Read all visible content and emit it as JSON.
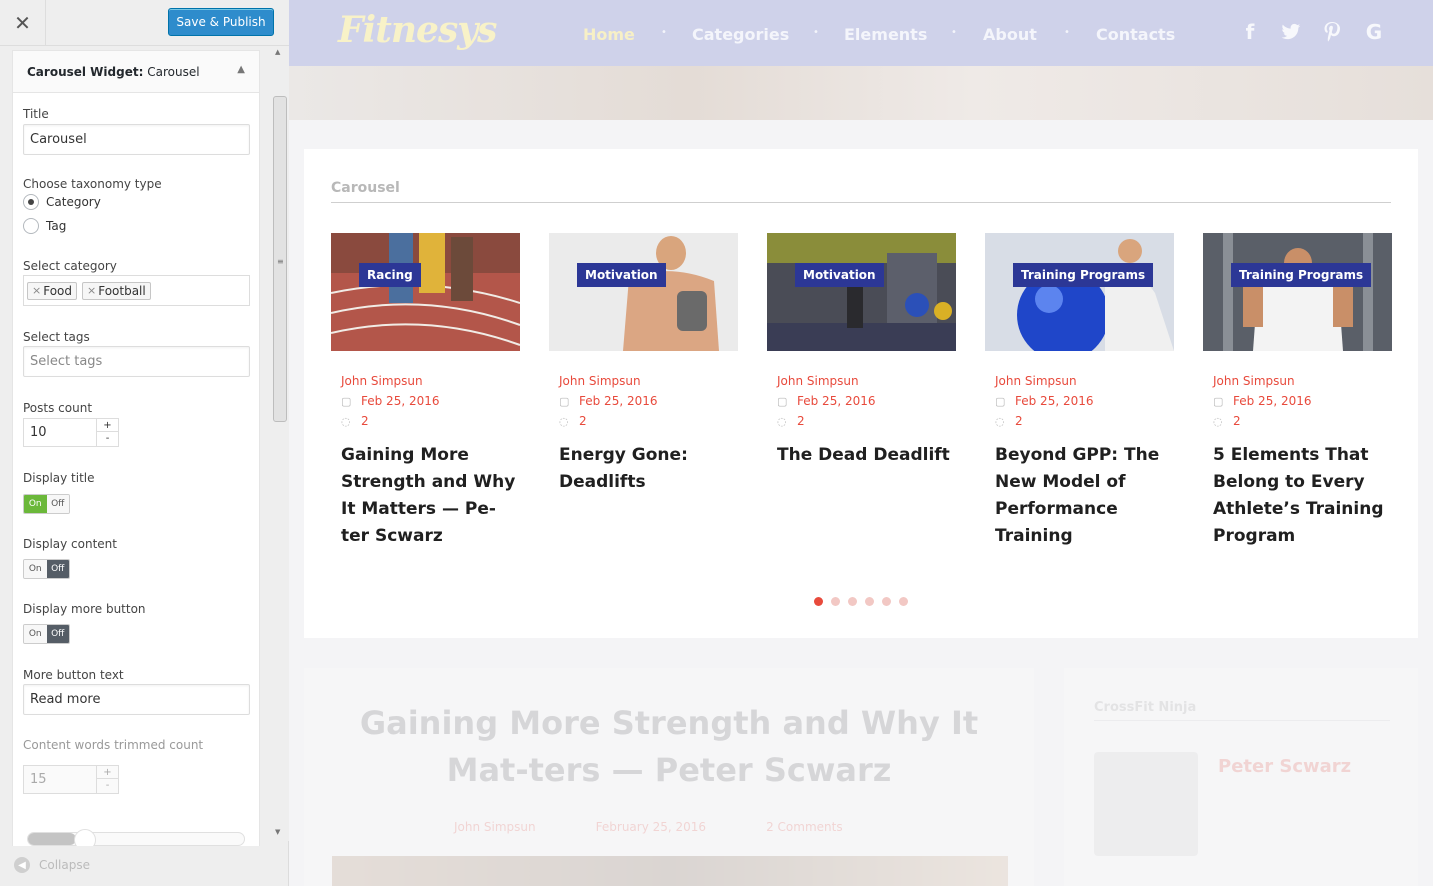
{
  "sidebar": {
    "close_icon": "close-icon",
    "publish_label": "Save & Publish",
    "widget_header": {
      "prefix": "Carousel Widget:",
      "name": "Carousel"
    },
    "fields": {
      "title_label": "Title",
      "title_value": "Carousel",
      "taxonomy_label": "Choose taxonomy type",
      "taxonomy_options": [
        "Category",
        "Tag"
      ],
      "taxonomy_selected": "Category",
      "category_label": "Select category",
      "categories": [
        "Food",
        "Football"
      ],
      "tags_label": "Select tags",
      "tags_placeholder": "Select tags",
      "posts_count_label": "Posts count",
      "posts_count_value": "10",
      "display_title_label": "Display title",
      "display_content_label": "Display content",
      "display_more_label": "Display more button",
      "toggle_on": "On",
      "toggle_off": "Off",
      "display_title_state": "on",
      "display_content_state": "off",
      "display_more_state": "off",
      "more_text_label": "More button text",
      "more_text_value": "Read more",
      "trim_label": "Content words trimmed count",
      "trim_value": "15"
    },
    "collapse_label": "Collapse"
  },
  "site": {
    "logo": "Fitnesys",
    "nav": [
      "Home",
      "Categories",
      "Elements",
      "About",
      "Contacts"
    ],
    "active_nav": "Home",
    "social": [
      "facebook-icon",
      "twitter-icon",
      "pinterest-icon",
      "google-icon"
    ],
    "carousel_heading": "Carousel",
    "slides": [
      {
        "badge": "Racing",
        "author": "John Simpsun",
        "date": "Feb 25, 2016",
        "comments": "2",
        "title": "Gaining More Strength and Why It Matters — Pe-ter Scwarz"
      },
      {
        "badge": "Motivation",
        "author": "John Simpsun",
        "date": "Feb 25, 2016",
        "comments": "2",
        "title": "Energy Gone: Deadlifts"
      },
      {
        "badge": "Motivation",
        "author": "John Simpsun",
        "date": "Feb 25, 2016",
        "comments": "2",
        "title": "The Dead Deadlift"
      },
      {
        "badge": "Training Programs",
        "author": "John Simpsun",
        "date": "Feb 25, 2016",
        "comments": "2",
        "title": "Beyond GPP: The New Model of Performance Training"
      },
      {
        "badge": "Training Programs",
        "author": "John Simpsun",
        "date": "Feb 25, 2016",
        "comments": "2",
        "title": "5 Elements That Belong to Every Athlete’s Training Program"
      }
    ],
    "dots_count": 6,
    "active_dot": 0,
    "post": {
      "title": "Gaining More Strength and Why It Mat-ters — Peter Scwarz",
      "author": "John Simpsun",
      "date": "February 25, 2016",
      "comments": "2 Comments"
    },
    "side_widget": {
      "title": "CrossFit Ninja",
      "name": "Peter Scwarz"
    },
    "colors": {
      "accent": "#e84a3c",
      "badge": "#2c3796",
      "publish": "#2e8ccc",
      "toggle_on": "#6bb83a"
    }
  }
}
